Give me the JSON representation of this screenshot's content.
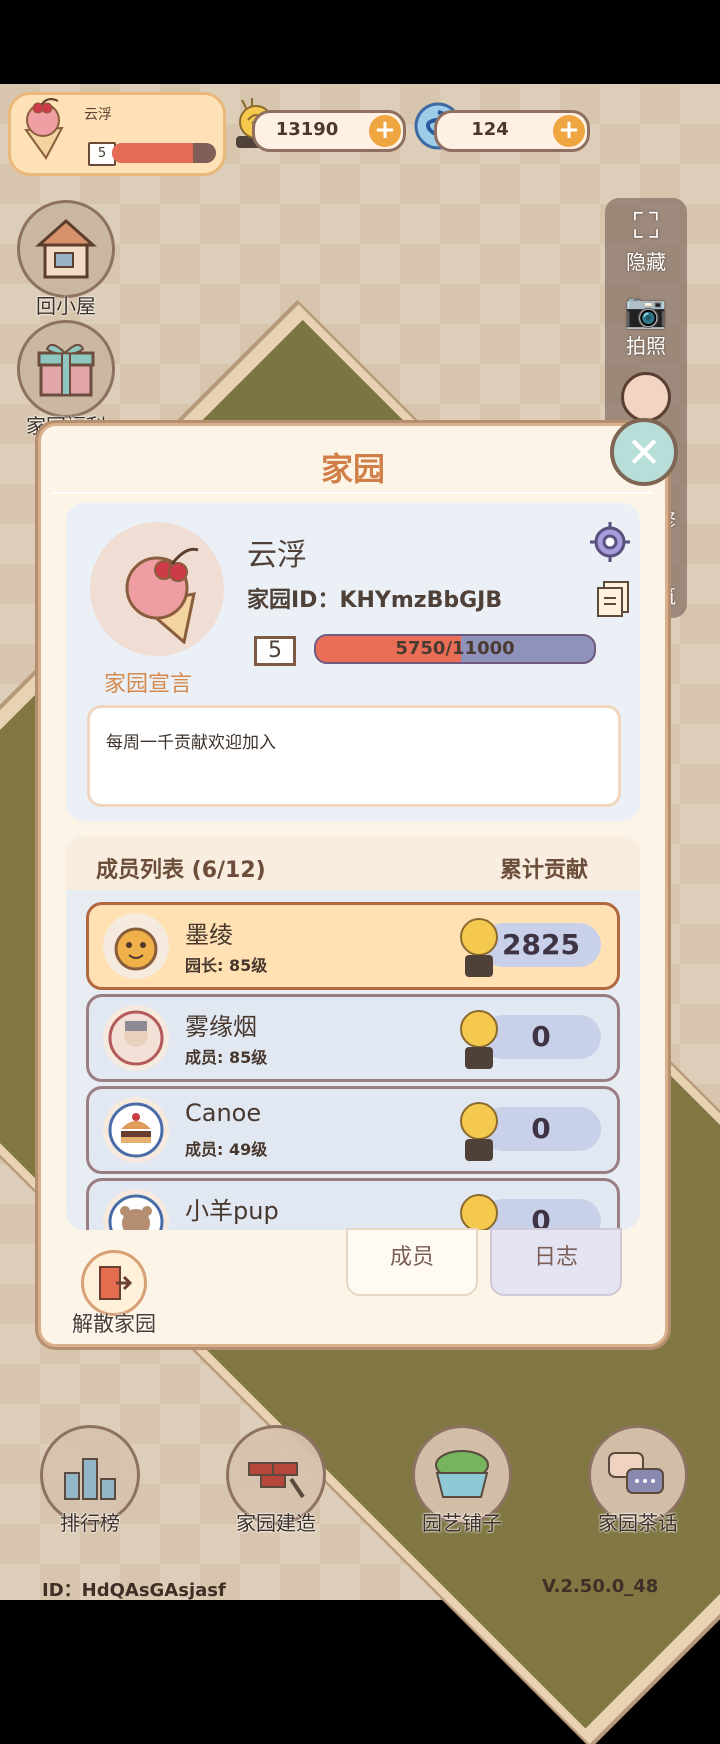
{
  "profile": {
    "name": "云浮",
    "level": "5",
    "progress": 0.78
  },
  "currencies": [
    {
      "amount": "13190",
      "icon": "snail-icon"
    },
    {
      "amount": "124",
      "icon": "swirl-gem-icon"
    }
  ],
  "left_buttons": [
    {
      "label": "回小屋",
      "icon": "house-icon"
    },
    {
      "label": "家园福利",
      "icon": "gift-box-icon"
    }
  ],
  "right_buttons": [
    {
      "label": "隐藏",
      "icon": "frame-icon"
    },
    {
      "label": "拍照",
      "icon": "camera-icon"
    },
    {
      "label": "修",
      "icon": "avatar-icon"
    },
    {
      "label": "筑",
      "icon": "build-icon"
    }
  ],
  "modal": {
    "title": "家园",
    "name": "云浮",
    "id_text": "家园ID：KHYmzBbGJB",
    "level": "5",
    "exp_text": "5750/11000",
    "exp_progress": 0.523,
    "manifesto_label": "家园宣言",
    "manifesto_text": "每周一千贡献欢迎加入",
    "members_header": "成员列表 (6/12)",
    "contribution_header": "累计贡献",
    "members": [
      {
        "name": "墨绫",
        "role": "园长: 85级",
        "score": "2825",
        "avatar": "pumpkin-avatar-icon"
      },
      {
        "name": "雾缘烟",
        "role": "成员: 85级",
        "score": "0",
        "avatar": "character-avatar-icon"
      },
      {
        "name": "Canoe",
        "role": "成员: 49级",
        "score": "0",
        "avatar": "burger-avatar-icon"
      },
      {
        "name": "小羊pup",
        "role": "",
        "score": "0",
        "avatar": "bear-avatar-icon"
      }
    ],
    "tabs": {
      "members": "成员",
      "log": "日志"
    },
    "disband_label": "解散家园"
  },
  "bottom_buttons": [
    {
      "label": "排行榜",
      "icon": "trophy-icon"
    },
    {
      "label": "家园建造",
      "icon": "brick-trowel-icon"
    },
    {
      "label": "园艺铺子",
      "icon": "flower-planter-icon"
    },
    {
      "label": "家园茶话",
      "icon": "chat-bubbles-icon"
    }
  ],
  "footer": {
    "id_text": "ID：HdQAsGAsjasf",
    "version": "V.2.50.0_48"
  }
}
